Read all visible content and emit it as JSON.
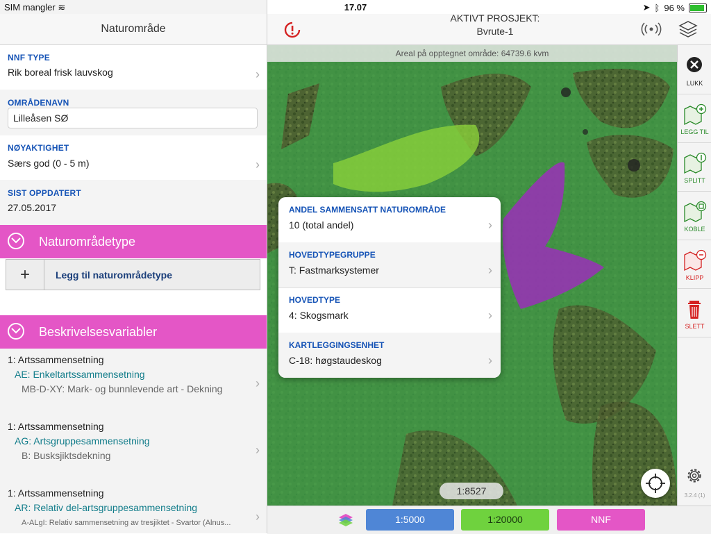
{
  "status": {
    "carrier": "SIM mangler",
    "time": "17.07",
    "battery": "96 %"
  },
  "left": {
    "title": "Naturområde",
    "fields": [
      {
        "label": "NNF TYPE",
        "value": "Rik boreal frisk lauvskog"
      },
      {
        "label": "OMRÅDENAVN",
        "value": "Lilleåsen SØ"
      },
      {
        "label": "NØYAKTIGHET",
        "value": "Særs god (0 - 5 m)"
      },
      {
        "label": "SIST OPPDATERT",
        "value": "27.05.2017"
      }
    ],
    "section1": "Naturområdetype",
    "add_label": "Legg til naturområdetype",
    "section2": "Beskrivelsesvariabler",
    "variables": [
      {
        "a": "1: Artssammensetning",
        "b": "AE: Enkeltartssammensetning",
        "c": "MB-D-XY: Mark- og bunnlevende art - Dekning"
      },
      {
        "a": "1: Artssammensetning",
        "b": "AG: Artsgruppesammensetning",
        "c": "B: Busksjiktsdekning"
      },
      {
        "a": "1: Artssammensetning",
        "b": "AR: Relativ del-artsgruppesammensetning",
        "c": "A-ALgI: Relativ sammensetning av tresjiktet - Svartor (Alnus..."
      }
    ]
  },
  "header": {
    "title": "AKTIVT PROSJEKT:",
    "project": "Bvrute-1"
  },
  "map": {
    "area": "Areal på opptegnet område: 64739.6 kvm",
    "scale": "1:8527",
    "popup": [
      {
        "label": "ANDEL SAMMENSATT NATUROMRÅDE",
        "value": "10 (total andel)"
      },
      {
        "label": "HOVEDTYPEGRUPPE",
        "value": "T: Fastmarksystemer"
      },
      {
        "label": "HOVEDTYPE",
        "value": "4: Skogsmark"
      },
      {
        "label": "KARTLEGGINGSENHET",
        "value": "C-18: høgstaudeskog"
      }
    ]
  },
  "tools": [
    {
      "label": "LUKK",
      "icon": "close-icon",
      "color": "#222222"
    },
    {
      "label": "LEGG TIL",
      "icon": "map-add-icon",
      "color": "#2a8a2a"
    },
    {
      "label": "SPLITT",
      "icon": "map-split-icon",
      "color": "#2a8a2a"
    },
    {
      "label": "KOBLE",
      "icon": "map-join-icon",
      "color": "#2a8a2a"
    },
    {
      "label": "KLIPP",
      "icon": "map-cut-icon",
      "color": "#d42222"
    },
    {
      "label": "SLETT",
      "icon": "trash-icon",
      "color": "#d42222"
    }
  ],
  "version": "3.2.4 (1)",
  "bottom": {
    "btn1": "1:5000",
    "btn1_color": "#4f86d6",
    "btn2": "1:20000",
    "btn2_color": "#6fd23e",
    "btn3": "NNF",
    "btn3_color": "#e456c6"
  }
}
